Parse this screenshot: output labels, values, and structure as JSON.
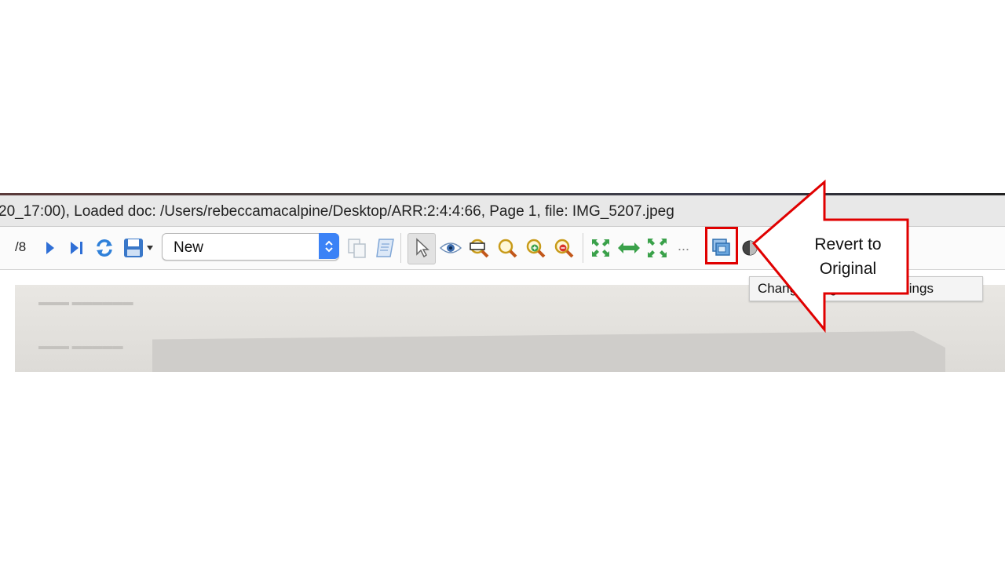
{
  "window": {
    "title": "20_17:00), Loaded doc: /Users/rebeccamacalpine/Desktop/ARR:2:4:4:66, Page 1, file: IMG_5207.jpeg"
  },
  "toolbar": {
    "page_total": "/8",
    "profile_select": {
      "value": "New"
    },
    "more_label": "...",
    "icons": [
      "next-page-icon",
      "last-page-icon",
      "reload-icon",
      "save-icon",
      "copy-icon",
      "script-icon",
      "pointer-icon",
      "view-icon",
      "zoom-rect-icon",
      "zoom-icon",
      "zoom-in-icon",
      "zoom-out-icon",
      "fit-page-icon",
      "fit-width-icon",
      "fit-actual-icon",
      "revert-original-icon",
      "contrast-icon"
    ]
  },
  "tooltip": {
    "text": "Change image to last settings"
  },
  "annotation": {
    "text": "Revert to Original",
    "color": "#e00000"
  }
}
